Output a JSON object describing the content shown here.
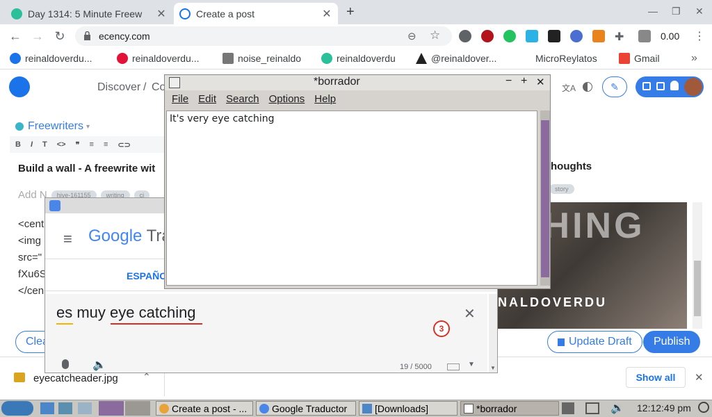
{
  "browser": {
    "tabs": [
      {
        "title": "Day 1314: 5 Minute Freew",
        "active": false
      },
      {
        "title": "Create a post",
        "active": true
      }
    ],
    "url": "ecency.com",
    "wallet_value": "0.00",
    "bookmarks": [
      {
        "label": "reinaldoverdu..."
      },
      {
        "label": "reinaldoverdu..."
      },
      {
        "label": "noise_reinaldo"
      },
      {
        "label": "reinaldoverdu"
      },
      {
        "label": "@reinaldover..."
      },
      {
        "label": "MicroReylatos"
      },
      {
        "label": "Gmail"
      }
    ],
    "more_bookmarks": "»"
  },
  "ecency": {
    "nav": {
      "discover": "Discover",
      "separator": "/",
      "create_partial": "Co"
    },
    "community": "Freewriters",
    "post_title": "Build a wall - A freewrite wit",
    "right_title": "houghts",
    "tags_placeholder": "Add N",
    "tags": [
      "hive-161155",
      "writing",
      "ci"
    ],
    "right_tag": "story",
    "body_lines": [
      "<cent",
      "<img",
      "src=\"",
      "fXu6S",
      "</cen"
    ],
    "clear_label": "Clea",
    "update_draft_label": "Update Draft",
    "publish_label": "Publish",
    "preview_text_top": "CHING",
    "preview_text_bottom": "NALDOVERDU"
  },
  "downloads": {
    "file": "eyecatcheader.jpg",
    "show_all": "Show all"
  },
  "borrador": {
    "title": "*borrador",
    "menu": [
      "File",
      "Edit",
      "Search",
      "Options",
      "Help"
    ],
    "content": "It's very eye catching"
  },
  "gtranslate": {
    "brand_google": "Google",
    "brand_rest": "Tra",
    "lang_label": "ESPAÑO",
    "output_text": "es muy eye catching",
    "badge_count": "3",
    "char_count": "19 / 5000"
  },
  "taskbar": {
    "tasks": [
      {
        "label": "Create a post - ..."
      },
      {
        "label": "Google Traductor"
      },
      {
        "label": "[Downloads]"
      },
      {
        "label": "*borrador"
      }
    ],
    "clock": "12:12:49 pm"
  }
}
